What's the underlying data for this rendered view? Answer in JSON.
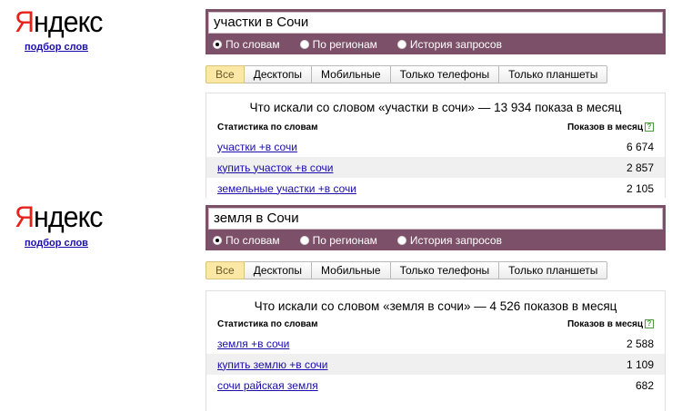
{
  "logo": {
    "first": "Я",
    "rest": "ндекс"
  },
  "word_link": "подбор слов",
  "radios": [
    "По словам",
    "По регионам",
    "История запросов"
  ],
  "tabs": [
    "Все",
    "Десктопы",
    "Мобильные",
    "Только телефоны",
    "Только планшеты"
  ],
  "colors": {
    "search_bar": "#7b5068",
    "active_tab": "#fbe8a5",
    "link": "#1a0dab",
    "logo_red": "#e8221b"
  },
  "icons": {
    "help": "question-mark-icon"
  },
  "columns": {
    "left": "Статистика по словам",
    "right": "Показов в месяц",
    "help": "?"
  },
  "panels": [
    {
      "query": "участки в Сочи",
      "summary": "Что искали со словом «участки в сочи» — 13 934 показа в месяц",
      "rows": [
        {
          "phrase": "участки +в сочи",
          "count": "6 674"
        },
        {
          "phrase": "купить участок +в сочи",
          "count": "2 857"
        },
        {
          "phrase": "земельные участки +в сочи",
          "count": "2 105"
        }
      ]
    },
    {
      "query": "земля в Сочи",
      "summary": "Что искали со словом «земля в сочи» — 4 526 показов в месяц",
      "rows": [
        {
          "phrase": "земля +в сочи",
          "count": "2 588"
        },
        {
          "phrase": "купить землю +в сочи",
          "count": "1 109"
        },
        {
          "phrase": "сочи райская земля",
          "count": "682"
        }
      ]
    }
  ]
}
